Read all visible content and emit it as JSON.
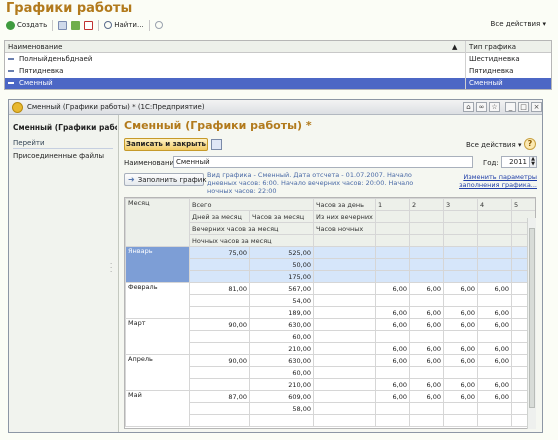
{
  "main": {
    "title": "Графики работы",
    "toolbar": {
      "create_label": "Создать",
      "find_label": "Найти...",
      "all_actions": "Все действия"
    },
    "columns": [
      "Наименование",
      "Тип графика"
    ],
    "rows": [
      {
        "name": "Полныйденьбднаей",
        "type": "Шестидневка",
        "selected": false
      },
      {
        "name": "Пятидневка",
        "type": "Пятидневка",
        "selected": false
      },
      {
        "name": "Сменный",
        "type": "Сменный",
        "selected": true
      }
    ]
  },
  "dialog": {
    "window_title": "Сменный (Графики работы) * (1С:Предприятие)",
    "left_title": "Сменный (Графики работы)",
    "nav_head": "Перейти",
    "nav_attached": "Присоединенные файлы",
    "form_title": "Сменный (Графики работы) *",
    "save_close": "Записать и закрыть",
    "all_actions": "Все действия",
    "help": "?",
    "name_label": "Наименование:",
    "name_value": "Сменный",
    "year_label": "Год:",
    "year_value": "2011",
    "fill_button": "Заполнить график",
    "info": "Вид графика - Сменный. Дата отсчета - 01.07.2007. Начало дневных часов: 6:00. Начало вечерних часов: 20:00. Начало ночных часов: 22:00",
    "params_link": "Изменить параметры заполнения графика..."
  },
  "grid": {
    "headers": {
      "month": "Месяц",
      "total": "Всего",
      "days": "Дней за месяц",
      "hours": "Часов за месяц",
      "evening": "Вечерних часов за месяц",
      "night": "Ночных часов за месяц",
      "per_day": "Часов за день",
      "of_evening": "Из них вечерних",
      "night_hours": "Часов ночных",
      "day_cols": [
        "1",
        "2",
        "3",
        "4",
        "5"
      ]
    },
    "months": [
      {
        "name": "Январь",
        "days": "75,00",
        "hours": [
          "525,00",
          "50,00",
          "175,00"
        ],
        "cells": [
          [
            "",
            "",
            "",
            "",
            ""
          ],
          [
            "",
            "",
            "",
            "",
            ""
          ],
          [
            "",
            "",
            "",
            "",
            ""
          ]
        ]
      },
      {
        "name": "Февраль",
        "days": "81,00",
        "hours": [
          "567,00",
          "54,00",
          "189,00"
        ],
        "cells": [
          [
            "6,00",
            "6,00",
            "6,00",
            "6,00",
            ""
          ],
          [
            "",
            "",
            "",
            "",
            ""
          ],
          [
            "6,00",
            "6,00",
            "6,00",
            "6,00",
            ""
          ]
        ]
      },
      {
        "name": "Март",
        "days": "90,00",
        "hours": [
          "630,00",
          "60,00",
          "210,00"
        ],
        "cells": [
          [
            "6,00",
            "6,00",
            "6,00",
            "6,00",
            ""
          ],
          [
            "",
            "",
            "",
            "",
            ""
          ],
          [
            "6,00",
            "6,00",
            "6,00",
            "6,00",
            ""
          ]
        ]
      },
      {
        "name": "Апрель",
        "days": "90,00",
        "hours": [
          "630,00",
          "60,00",
          "210,00"
        ],
        "cells": [
          [
            "6,00",
            "6,00",
            "6,00",
            "6,00",
            ""
          ],
          [
            "",
            "",
            "",
            "",
            ""
          ],
          [
            "6,00",
            "6,00",
            "6,00",
            "6,00",
            ""
          ]
        ]
      },
      {
        "name": "Май",
        "days": "87,00",
        "hours": [
          "609,00",
          "58,00",
          ""
        ],
        "cells": [
          [
            "6,00",
            "6,00",
            "6,00",
            "6,00",
            ""
          ],
          [
            "",
            "",
            "",
            "",
            ""
          ],
          [
            "",
            "",
            "",
            "",
            ""
          ]
        ]
      }
    ]
  },
  "colors": {
    "accent": "#b27a1c",
    "selection": "#4c67c5",
    "grid_selection": "#d6e6fa"
  }
}
